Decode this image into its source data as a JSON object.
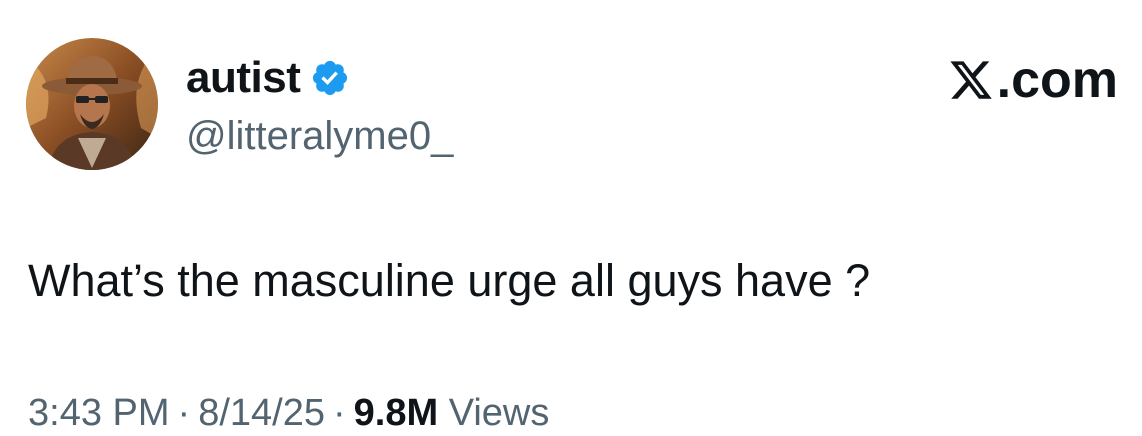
{
  "author": {
    "display_name": "autist",
    "handle": "@litteralyme0_",
    "verified": true,
    "avatar_icon": "cowboy-avatar",
    "verified_color": "#1d9bf0"
  },
  "brand": {
    "label": ".com",
    "icon": "x-logo-icon"
  },
  "tweet": {
    "text": "What’s the masculine urge all guys have ?"
  },
  "meta": {
    "time": "3:43 PM",
    "separator": "·",
    "date": "8/14/25",
    "views_count": "9.8M",
    "views_label": "Views"
  },
  "colors": {
    "text_primary": "#0f1419",
    "text_secondary": "#536471",
    "background": "#ffffff"
  }
}
